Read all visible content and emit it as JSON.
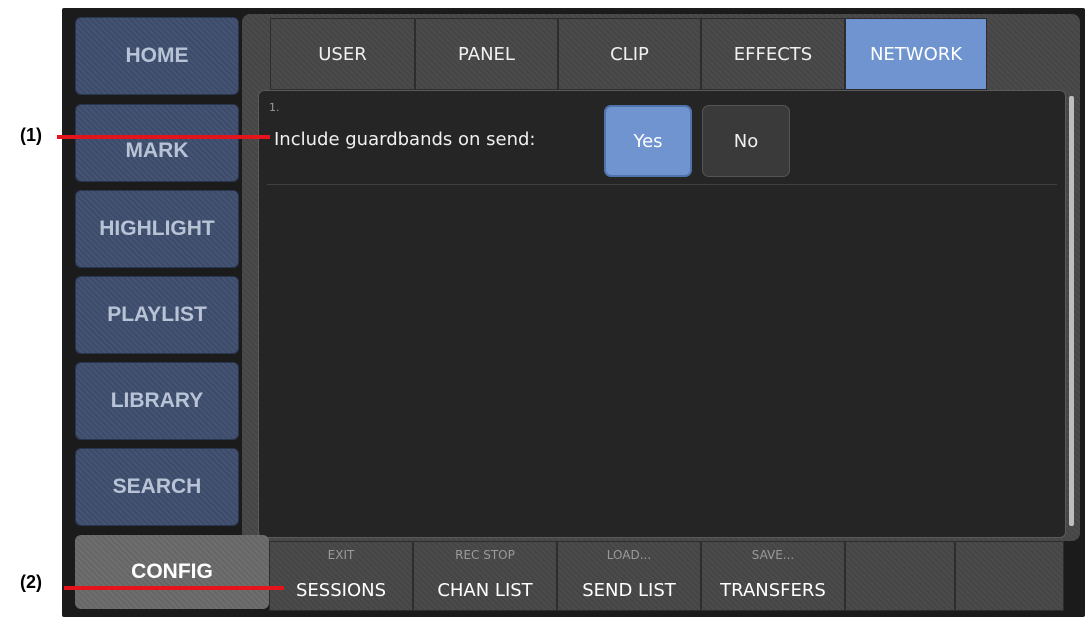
{
  "nav": {
    "items": [
      {
        "label": "HOME"
      },
      {
        "label": "MARK"
      },
      {
        "label": "HIGHLIGHT"
      },
      {
        "label": "PLAYLIST"
      },
      {
        "label": "LIBRARY"
      },
      {
        "label": "SEARCH"
      }
    ],
    "config_label": "CONFIG"
  },
  "tabs": [
    {
      "label": "USER"
    },
    {
      "label": "PANEL"
    },
    {
      "label": "CLIP"
    },
    {
      "label": "EFFECTS"
    },
    {
      "label": "NETWORK",
      "active": true
    }
  ],
  "setting": {
    "number": "1.",
    "label": "Include guardbands on send:",
    "yes_label": "Yes",
    "no_label": "No",
    "selected": "Yes"
  },
  "bottom_buttons": [
    {
      "small": "EXIT",
      "main": "SESSIONS"
    },
    {
      "small": "REC STOP",
      "main": "CHAN LIST"
    },
    {
      "small": "LOAD...",
      "main": "SEND LIST"
    },
    {
      "small": "SAVE...",
      "main": "TRANSFERS"
    },
    {
      "small": "",
      "main": ""
    },
    {
      "small": "",
      "main": ""
    }
  ],
  "annotations": {
    "callout_1": "(1)",
    "callout_2": "(2)"
  },
  "colors": {
    "accent": "#6f94cf",
    "nav_blue": "#3e4e6e",
    "callout_line": "#e4141c"
  }
}
